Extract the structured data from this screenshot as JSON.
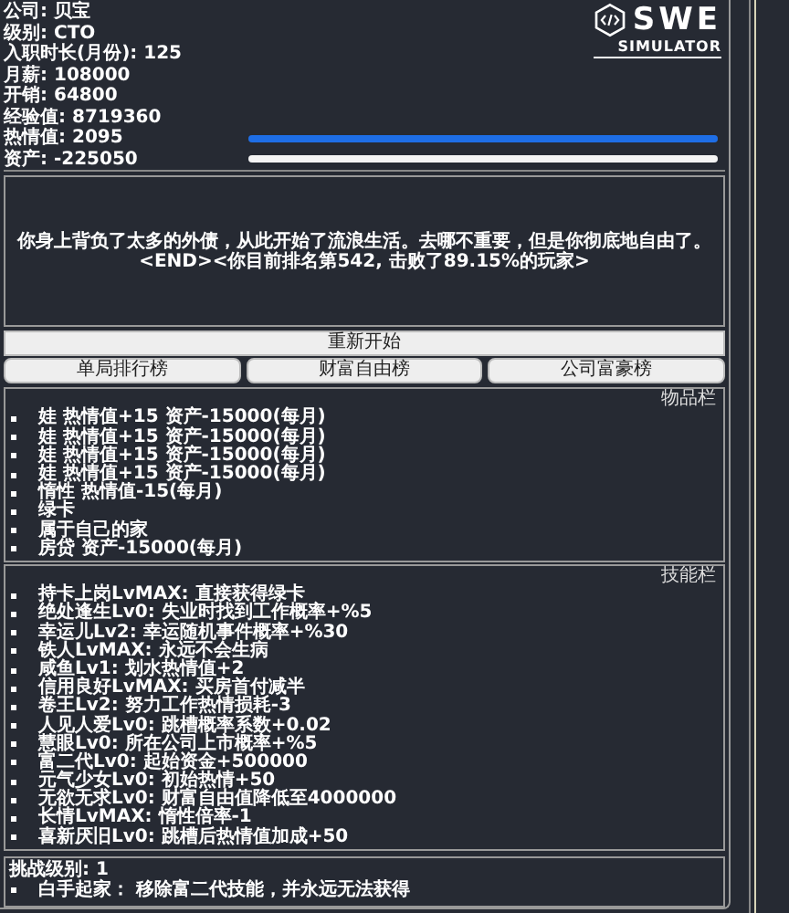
{
  "logo": {
    "title": "SWE",
    "subtitle": "SIMULATOR"
  },
  "stats": [
    {
      "text": "公司: 贝宝"
    },
    {
      "text": "级别: CTO"
    },
    {
      "text": "入职时长(月份): 125"
    },
    {
      "text": "月薪: 108000"
    },
    {
      "text": "开销: 64800"
    },
    {
      "text": "经验值: 8719360"
    },
    {
      "text": "热情值: 2095",
      "level": 1,
      "color": "#1e6ee6"
    },
    {
      "text": "资产: -225050",
      "level": 1,
      "color": "#f4f4f4"
    }
  ],
  "message": "你身上背负了太多的外债，从此开始了流浪生活。去哪不重要，但是你彻底地自由了。<END><你目前排名第542, 击败了89.15%的玩家>",
  "restart_button": "重新开始",
  "leaderboards": [
    "单局排行榜",
    "财富自由榜",
    "公司富豪榜"
  ],
  "inventory": {
    "title": "物品栏",
    "items": [
      "娃 热情值+15 资产-15000(每月)",
      "娃 热情值+15 资产-15000(每月)",
      "娃 热情值+15 资产-15000(每月)",
      "娃 热情值+15 资产-15000(每月)",
      "惰性 热情值-15(每月)",
      "绿卡",
      "属于自己的家",
      "房贷 资产-15000(每月)"
    ]
  },
  "skills": {
    "title": "技能栏",
    "items": [
      "持卡上岗LvMAX: 直接获得绿卡",
      "绝处逢生Lv0: 失业时找到工作概率+%5",
      "幸运儿Lv2: 幸运随机事件概率+%30",
      "铁人LvMAX: 永远不会生病",
      "咸鱼Lv1: 划水热情值+2",
      "信用良好LvMAX: 买房首付减半",
      "卷王Lv2: 努力工作热情损耗-3",
      "人见人爱Lv0: 跳槽概率系数+0.02",
      "慧眼Lv0: 所在公司上市概率+%5",
      "富二代Lv0: 起始资金+500000",
      "元气少女Lv0: 初始热情+50",
      "无欲无求Lv0: 财富自由值降低至4000000",
      "长情LvMAX: 惰性倍率-1",
      "喜新厌旧Lv0: 跳槽后热情值加成+50"
    ]
  },
  "challenge": {
    "title": "挑战级别: 1",
    "items": [
      "白手起家： 移除富二代技能，并永远无法获得"
    ]
  }
}
